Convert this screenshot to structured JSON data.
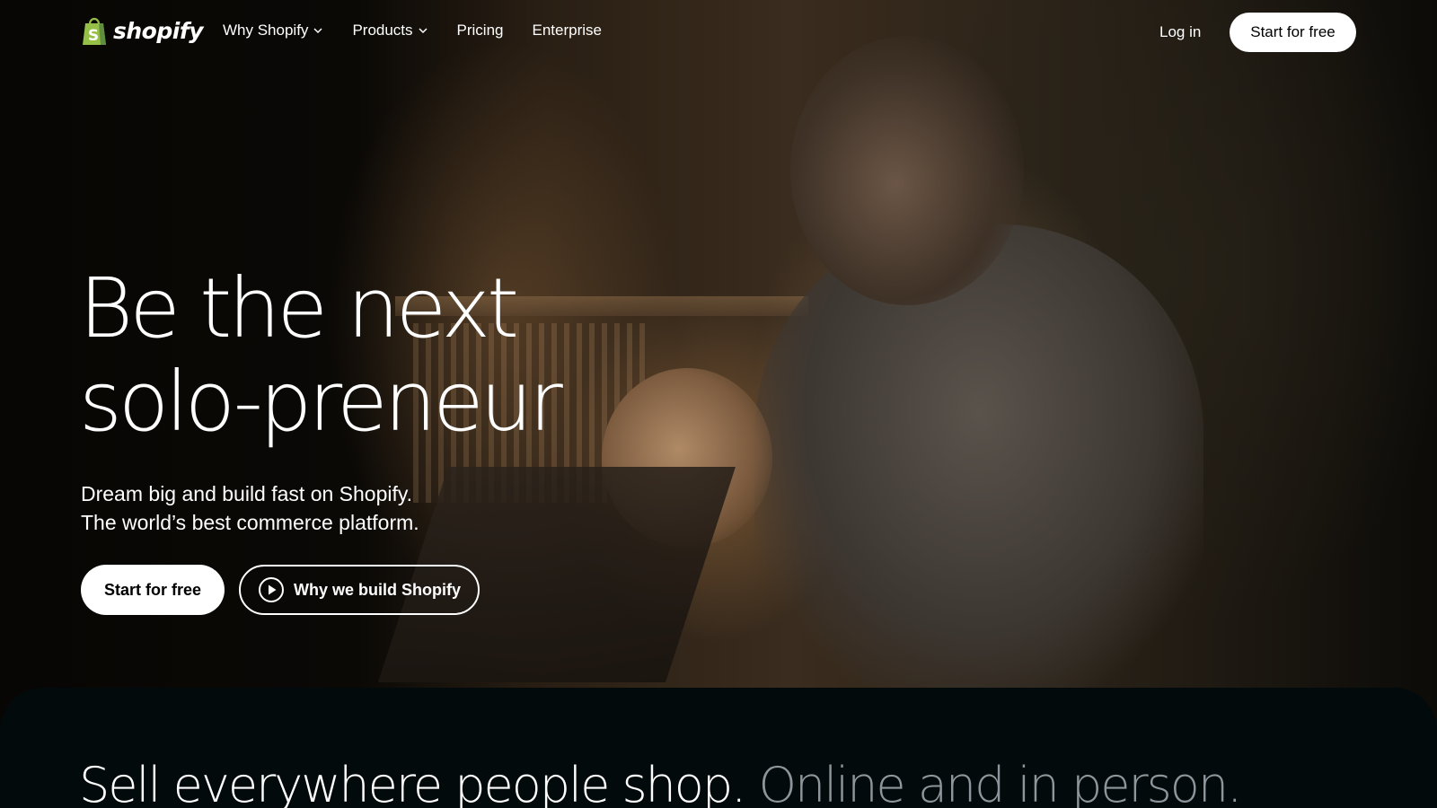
{
  "brand": {
    "name": "shopify",
    "logo_icon": "shopping-bag-icon",
    "logo_color": "#95bf47"
  },
  "nav": {
    "items": [
      {
        "label": "Why Shopify",
        "has_dropdown": true
      },
      {
        "label": "Products",
        "has_dropdown": true
      },
      {
        "label": "Pricing",
        "has_dropdown": false
      },
      {
        "label": "Enterprise",
        "has_dropdown": false
      }
    ],
    "login_label": "Log in",
    "cta_label": "Start for free"
  },
  "hero": {
    "headline_line1": "Be the next",
    "headline_line2": "solo-preneur",
    "subtext_line1": "Dream big and build fast on Shopify.",
    "subtext_line2": "The world’s best commerce platform.",
    "primary_cta": "Start for free",
    "secondary_cta": "Why we build Shopify",
    "secondary_cta_icon": "play-circle-icon"
  },
  "section": {
    "heading_primary": "Sell everywhere people shop.",
    "heading_muted": "Online and in person."
  },
  "colors": {
    "accent_green": "#95bf47",
    "button_bg": "#ffffff",
    "panel_bg": "#020a0c",
    "muted_text": "#8e969b"
  }
}
